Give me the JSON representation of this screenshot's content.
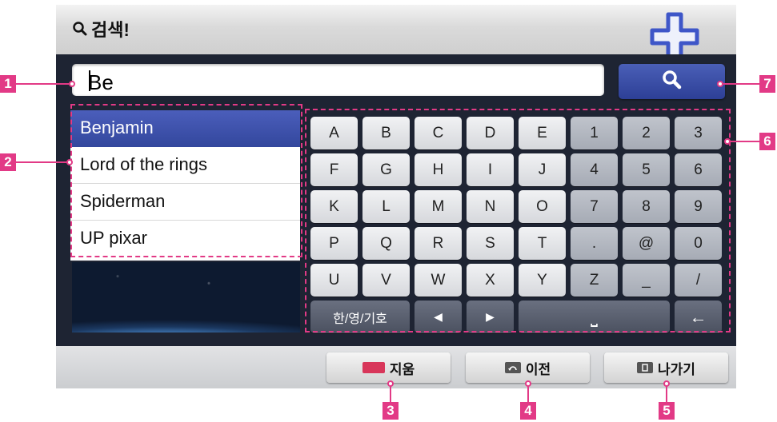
{
  "header": {
    "title": "검색!"
  },
  "search": {
    "value": "Be",
    "button_icon": "search-icon"
  },
  "results": [
    "Benjamin",
    "Lord of the rings",
    "Spiderman",
    "UP pixar"
  ],
  "keyboard": {
    "rows": [
      [
        "A",
        "B",
        "C",
        "D",
        "E",
        "1",
        "2",
        "3"
      ],
      [
        "F",
        "G",
        "H",
        "I",
        "J",
        "4",
        "5",
        "6"
      ],
      [
        "K",
        "L",
        "M",
        "N",
        "O",
        "7",
        "8",
        "9"
      ],
      [
        "P",
        "Q",
        "R",
        "S",
        "T",
        ".",
        "@",
        "0"
      ],
      [
        "U",
        "V",
        "W",
        "X",
        "Y",
        "Z",
        "_",
        "/"
      ]
    ],
    "lang_key": "한/영/기호",
    "left_key": "◀",
    "right_key": "▶",
    "space_key": "⎵",
    "back_key": "←"
  },
  "footer": {
    "delete_label": "지움",
    "prev_label": "이전",
    "exit_label": "나가기"
  },
  "callouts": [
    "1",
    "2",
    "3",
    "4",
    "5",
    "6",
    "7"
  ],
  "colors": {
    "accent": "#e23a86",
    "brand_blue": "#3a4ea6",
    "red_button": "#d8365a"
  }
}
